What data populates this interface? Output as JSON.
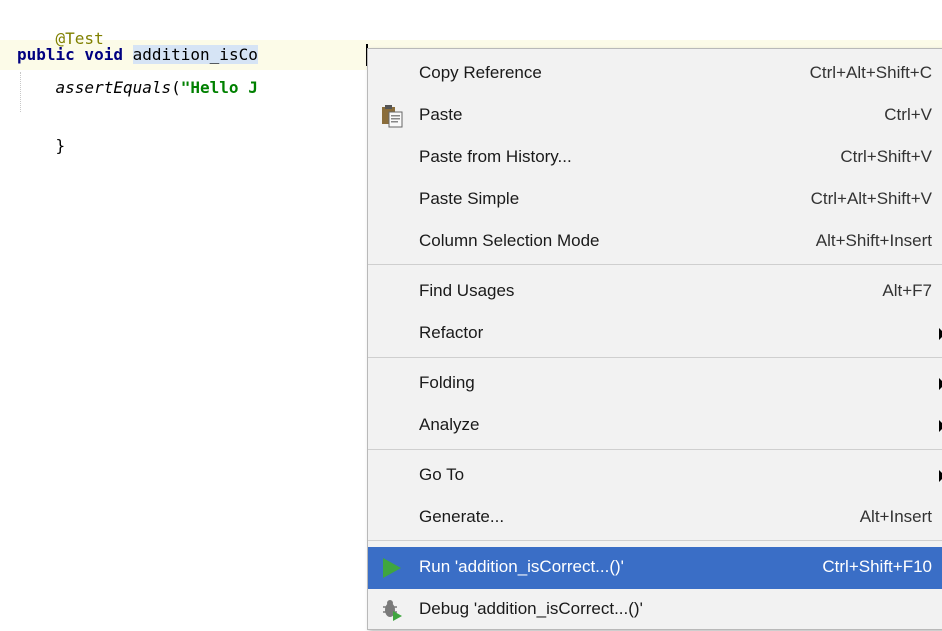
{
  "editor": {
    "annotation": "@Test",
    "sig_keywords": "public void",
    "sig_space": " ",
    "method_name": "addition_isCo",
    "body_indent": "    ",
    "body_call": "assertEquals",
    "body_paren": "(",
    "body_string": "\"Hello J",
    "closing_brace": "}"
  },
  "context_menu": {
    "items": [
      {
        "label": "Copy Reference",
        "shortcut": "Ctrl+Alt+Shift+C"
      },
      {
        "label": "Paste",
        "shortcut": "Ctrl+V",
        "icon": "paste-icon"
      },
      {
        "label": "Paste from History...",
        "shortcut": "Ctrl+Shift+V"
      },
      {
        "label": "Paste Simple",
        "shortcut": "Ctrl+Alt+Shift+V"
      },
      {
        "label": "Column Selection Mode",
        "shortcut": "Alt+Shift+Insert"
      },
      {
        "label": "Find Usages",
        "shortcut": "Alt+F7"
      },
      {
        "label": "Refactor",
        "submenu": true
      },
      {
        "label": "Folding",
        "submenu": true
      },
      {
        "label": "Analyze",
        "submenu": true
      },
      {
        "label": "Go To",
        "submenu": true
      },
      {
        "label": "Generate...",
        "shortcut": "Alt+Insert"
      },
      {
        "label": "Run 'addition_isCorrect...()'",
        "shortcut": "Ctrl+Shift+F10",
        "icon": "run-icon",
        "highlighted": true
      },
      {
        "label": "Debug 'addition_isCorrect...()'",
        "icon": "debug-icon"
      }
    ]
  },
  "colors": {
    "highlight": "#3a6ec6",
    "menu_background": "#f2f2f2",
    "annotation": "#808000",
    "keyword": "#000080",
    "string": "#008000",
    "run_icon": "#3fa63f"
  }
}
